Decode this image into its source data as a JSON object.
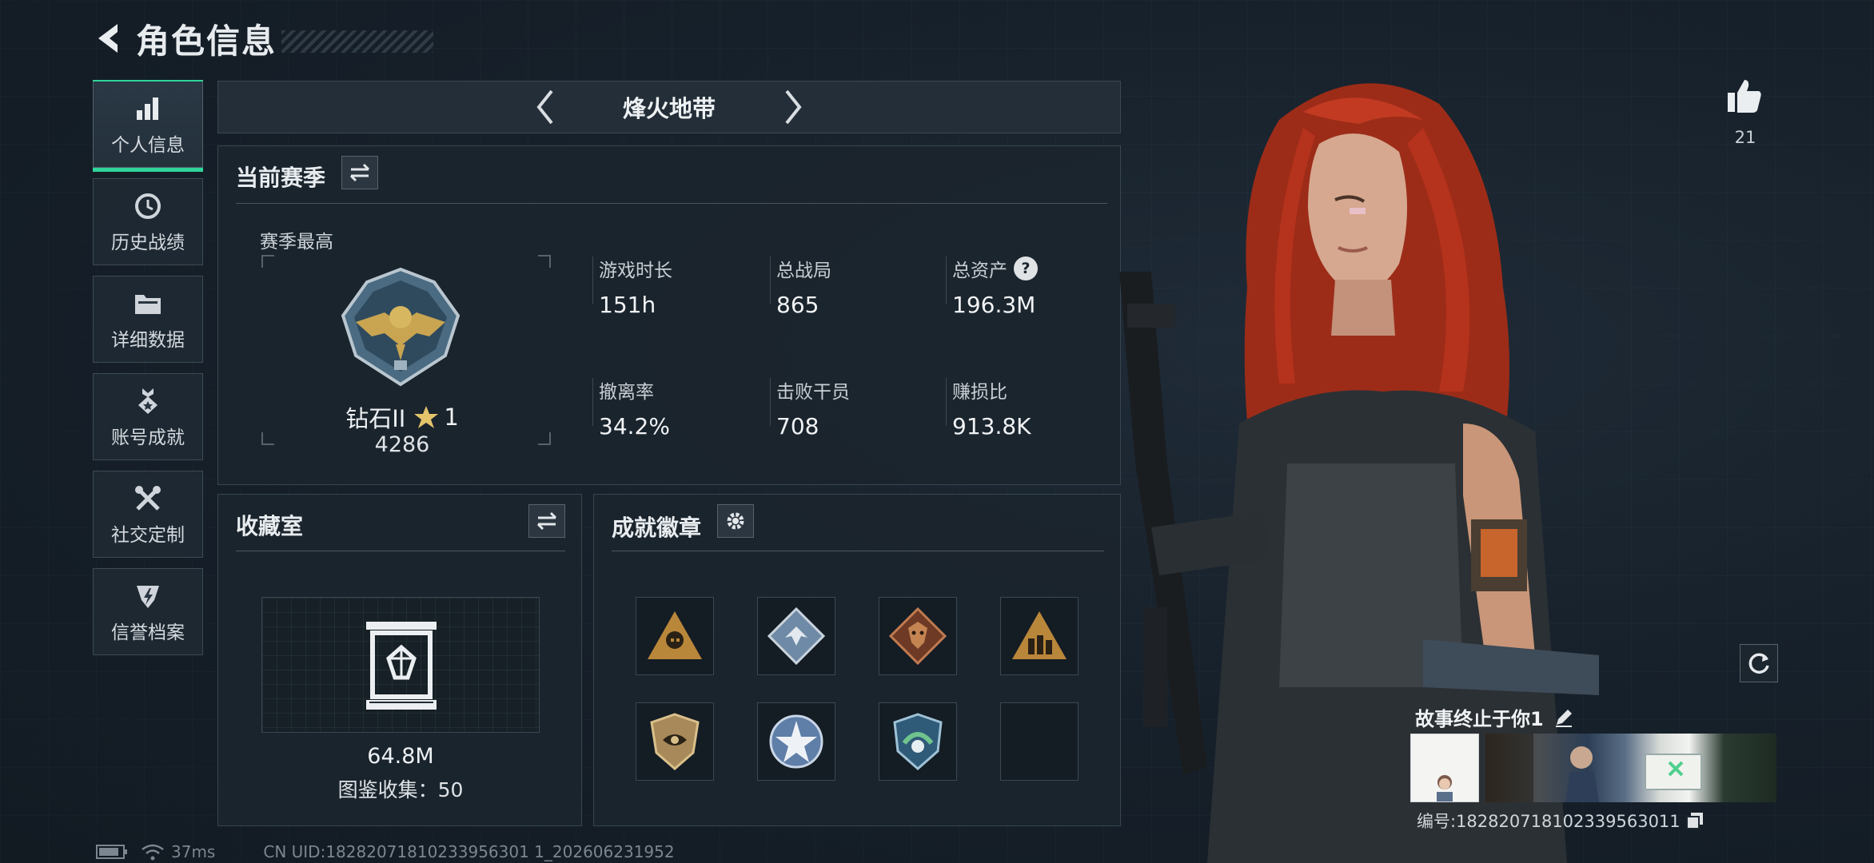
{
  "header": {
    "title": "角色信息"
  },
  "sidebar": {
    "items": [
      {
        "label": "个人信息",
        "icon": "bar-chart-icon",
        "active": true
      },
      {
        "label": "历史战绩",
        "icon": "history-clock-icon",
        "active": false
      },
      {
        "label": "详细数据",
        "icon": "folder-icon",
        "active": false
      },
      {
        "label": "账号成就",
        "icon": "medal-icon",
        "active": false
      },
      {
        "label": "社交定制",
        "icon": "tools-icon",
        "active": false
      },
      {
        "label": "信誉档案",
        "icon": "shield-lightning-icon",
        "active": false
      }
    ]
  },
  "mode": {
    "name": "烽火地带"
  },
  "season": {
    "title": "当前赛季",
    "best_label": "赛季最高",
    "rank_name": "钻石II",
    "rank_stars": "1",
    "rank_points": "4286",
    "stats": [
      {
        "label": "游戏时长",
        "value": "151h"
      },
      {
        "label": "总战局",
        "value": "865"
      },
      {
        "label": "总资产",
        "value": "196.3M",
        "help": "?"
      },
      {
        "label": "撤离率",
        "value": "34.2%"
      },
      {
        "label": "击败干员",
        "value": "708"
      },
      {
        "label": "赚损比",
        "value": "913.8K"
      }
    ]
  },
  "collection": {
    "title": "收藏室",
    "value": "64.8M",
    "catalog_label": "图鉴收集：50"
  },
  "achievements": {
    "title": "成就徽章",
    "badges": [
      {
        "icon": "pyramid-skull-badge-icon",
        "color": "#b9873a"
      },
      {
        "icon": "diamond-bird-badge-icon",
        "color": "#6e8aa6"
      },
      {
        "icon": "dragon-diamond-badge-icon",
        "color": "#b0552d"
      },
      {
        "icon": "pyramid-figures-badge-icon",
        "color": "#b9873a"
      },
      {
        "icon": "eye-shield-badge-icon",
        "color": "#a8895a"
      },
      {
        "icon": "star-circle-badge-icon",
        "color": "#5f7ea8"
      },
      {
        "icon": "green-emblem-badge-icon",
        "color": "#4a8a6a"
      },
      {
        "icon": "empty-slot",
        "color": ""
      }
    ]
  },
  "profile": {
    "likes": "21",
    "nickname": "故事终止于你1",
    "id_label": "编号:18282071810233956301​1"
  },
  "status_bar": {
    "ping": "37ms",
    "uid": "CN UID:18282071810233956301 1_202606231952"
  },
  "colors": {
    "accent": "#2fd59a",
    "hair": "#b5321c"
  }
}
